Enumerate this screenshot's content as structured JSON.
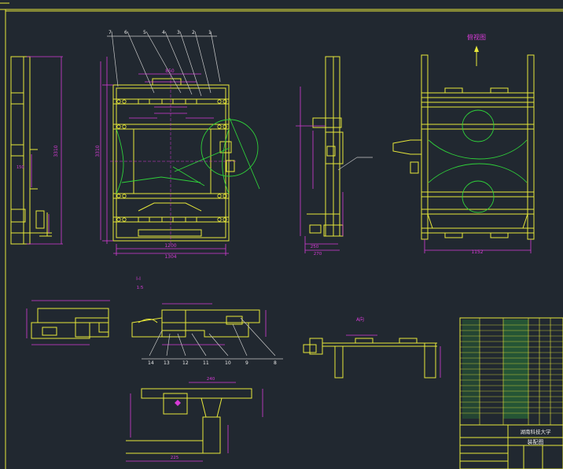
{
  "colors": {
    "background": "#212830",
    "frame": "#e8e83a",
    "geometry": "#e8e83a",
    "dimension": "#d63bd6",
    "leader": "#c8c8c8",
    "green_circle": "#2fd13a",
    "table_fill": "#2a7a3a"
  },
  "front_view": {
    "callouts": [
      "7",
      "6",
      "5",
      "4",
      "3",
      "2",
      "1"
    ],
    "dims": {
      "top_span": "850",
      "bottom_width": "1200",
      "overall_width": "1304",
      "height": "3310"
    }
  },
  "left_view": {
    "dims": {
      "height": "3310"
    }
  },
  "side_view": {
    "dims": {
      "width_a": "250",
      "width_b": "270"
    }
  },
  "right_view": {
    "title": "俯视图",
    "dims": {
      "width": "1152"
    }
  },
  "section_detail": {
    "label": "I-I",
    "scale": "1:5",
    "callouts": [
      "14",
      "13",
      "12",
      "11",
      "10",
      "9",
      "8"
    ],
    "dims": {
      "bottom": "225",
      "mid": "240"
    }
  },
  "section_a": {
    "label": "A向"
  },
  "title_block": {
    "drawing_title": "装配图",
    "company": "湖南科技大学"
  }
}
